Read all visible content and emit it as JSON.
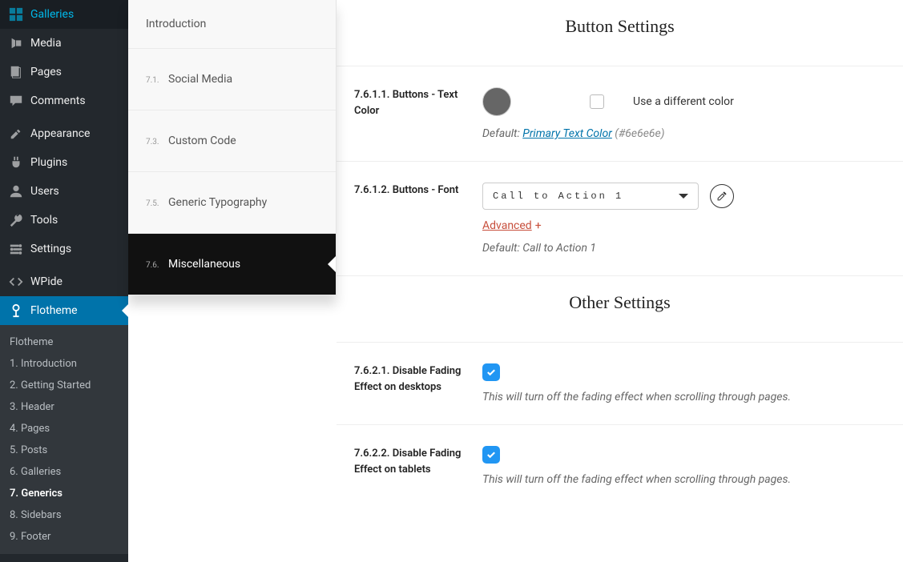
{
  "wp_sidebar": {
    "items": [
      {
        "label": "Galleries",
        "icon": "galleries"
      },
      {
        "label": "Media",
        "icon": "media"
      },
      {
        "label": "Pages",
        "icon": "pages"
      },
      {
        "label": "Comments",
        "icon": "comments"
      }
    ],
    "items2": [
      {
        "label": "Appearance",
        "icon": "appearance"
      },
      {
        "label": "Plugins",
        "icon": "plugins"
      },
      {
        "label": "Users",
        "icon": "users"
      },
      {
        "label": "Tools",
        "icon": "tools"
      },
      {
        "label": "Settings",
        "icon": "settings"
      }
    ],
    "items3": [
      {
        "label": "WPide",
        "icon": "code"
      },
      {
        "label": "Flotheme",
        "icon": "flotheme",
        "active": true
      }
    ],
    "submenu": {
      "head": "Flotheme",
      "items": [
        "1. Introduction",
        "2. Getting Started",
        "3. Header",
        "4. Pages",
        "5. Posts",
        "6. Galleries",
        "7. Generics",
        "8. Sidebars",
        "9. Footer"
      ],
      "current_index": 6
    }
  },
  "settings_nav": {
    "intro": "Introduction",
    "items": [
      {
        "num": "7.1.",
        "label": "Social Media"
      },
      {
        "num": "7.3.",
        "label": "Custom Code"
      },
      {
        "num": "7.5.",
        "label": "Generic Typography"
      },
      {
        "num": "7.6.",
        "label": "Miscellaneous",
        "active": true
      }
    ]
  },
  "content": {
    "section1_title": "Button Settings",
    "setting1": {
      "label": "7.6.1.1. Buttons - Text Color",
      "checkbox_label": "Use a different color",
      "default_prefix": "Default: ",
      "default_link": "Primary Text Color",
      "default_suffix": " (#6e6e6e)",
      "swatch_color": "#666666"
    },
    "setting2": {
      "label": "7.6.1.2. Buttons - Font",
      "select_value": "Call to Action 1",
      "advanced": "Advanced",
      "advanced_plus": "+",
      "default_text": "Default: Call to Action 1"
    },
    "section2_title": "Other Settings",
    "setting3": {
      "label": "7.6.2.1. Disable Fading Effect on desktops",
      "helper": "This will turn off the fading effect when scrolling through pages."
    },
    "setting4": {
      "label": "7.6.2.2. Disable Fading Effect on tablets",
      "helper": "This will turn off the fading effect when scrolling through pages."
    }
  }
}
